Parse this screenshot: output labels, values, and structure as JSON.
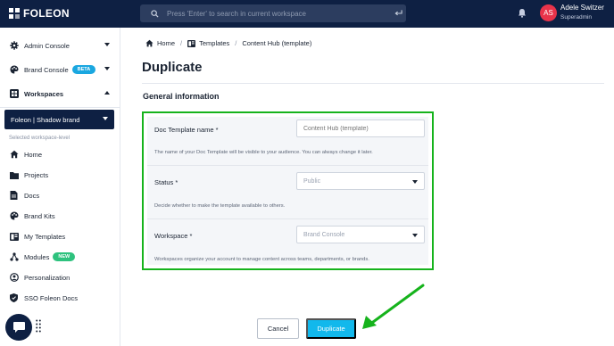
{
  "app": {
    "logo_text": "FOLEON",
    "search_placeholder": "Press 'Enter' to search in current workspace"
  },
  "user": {
    "initials": "AS",
    "name": "Adele Switzer",
    "role": "Superadmin"
  },
  "sidebar": {
    "admin_console": "Admin Console",
    "brand_console": "Brand Console",
    "brand_console_badge": "BETA",
    "workspaces": "Workspaces",
    "current_workspace": "Foleon | Shadow brand",
    "workspace_level_label": "Selected workspace-level",
    "items": [
      {
        "label": "Home",
        "icon": "home-icon"
      },
      {
        "label": "Projects",
        "icon": "folder-icon"
      },
      {
        "label": "Docs",
        "icon": "doc-icon"
      },
      {
        "label": "Brand Kits",
        "icon": "palette-icon"
      },
      {
        "label": "My Templates",
        "icon": "template-icon"
      },
      {
        "label": "Modules",
        "icon": "modules-icon",
        "badge": "NEW"
      },
      {
        "label": "Personalization",
        "icon": "person-icon"
      },
      {
        "label": "SSO Foleon Docs",
        "icon": "shield-icon"
      }
    ]
  },
  "breadcrumb": {
    "home": "Home",
    "templates": "Templates",
    "current": "Content Hub (template)"
  },
  "page": {
    "title": "Duplicate",
    "section_title": "General information"
  },
  "form": {
    "template_name": {
      "label": "Doc Template name *",
      "placeholder": "Content Hub (template)",
      "help": "The name of your Doc Template will be visible to your audience. You can always change it later."
    },
    "status": {
      "label": "Status *",
      "value": "Public",
      "help": "Decide whether to make the template available to others."
    },
    "workspace": {
      "label": "Workspace *",
      "value": "Brand Console",
      "help": "Workspaces organize your account to manage content across teams, departments, or brands."
    }
  },
  "actions": {
    "cancel": "Cancel",
    "duplicate": "Duplicate"
  },
  "colors": {
    "navy": "#0e2043",
    "accent": "#12b8ec",
    "highlight": "#16b31c",
    "avatar": "#e8334a"
  }
}
